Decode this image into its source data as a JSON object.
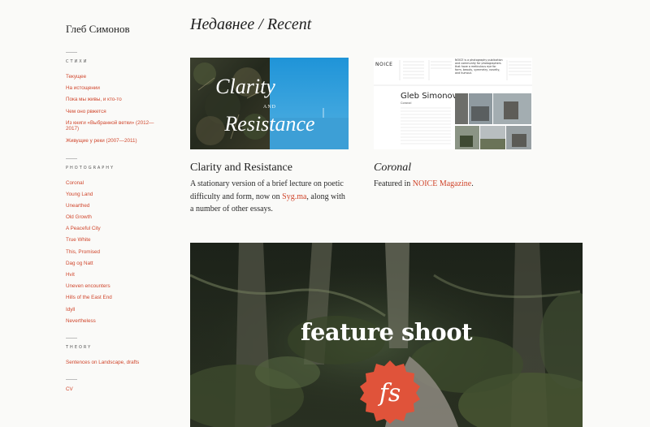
{
  "site": {
    "title": "Глеб Симонов"
  },
  "page": {
    "heading": "Недавнее / Recent"
  },
  "sidebar": {
    "sections": [
      {
        "heading": "СТИХИ",
        "items": [
          "Текущее",
          "На истощении",
          "Пока мы живы, и кто-то",
          "Чем оно рвжется",
          "Из книги «Выбранной ветки» (2012—2017)",
          "Живущие у реки (2007—2011)"
        ]
      },
      {
        "heading": "PHOTOGRAPHY",
        "items": [
          "Coronal",
          "Young Land",
          "Unearthed",
          "Old Growth",
          "A Peaceful City",
          "True White",
          "This, Promised",
          "Dag og Natt",
          "Hvit",
          "Uneven encounters",
          "Hills of the East End",
          "Idyll",
          "Nevertheless"
        ]
      },
      {
        "heading": "THEORY",
        "items": [
          "Sentences on Landscape, drafts"
        ]
      },
      {
        "heading": "",
        "items": [
          "CV"
        ]
      }
    ]
  },
  "cards": [
    {
      "title": "Clarity and Resistance",
      "desc_before": "A stationary version of a brief lecture on poetic difficulty and form, now on ",
      "link_text": "Syg.ma",
      "desc_after": ", along with a number of other essays.",
      "thumb_text": {
        "line1": "Clarity",
        "line2": "AND",
        "line3": "Resistance"
      }
    },
    {
      "title": "Coronal",
      "desc_before": "Featured in ",
      "link_text": "NOICE Magazine",
      "desc_after": ".",
      "thumb_text": {
        "name": "Gleb Simonov",
        "logo": "NOICE",
        "sub": "Coronal",
        "blurb": "NOICE is a photography publication and community for photographers that have a meticulous eye for form, beauty, symmetry, novelty, and humour."
      }
    }
  ],
  "hero": {
    "text": "feature shoot",
    "badge": "fs"
  },
  "colors": {
    "accent": "#d0462c",
    "background": "#fafaf8"
  }
}
